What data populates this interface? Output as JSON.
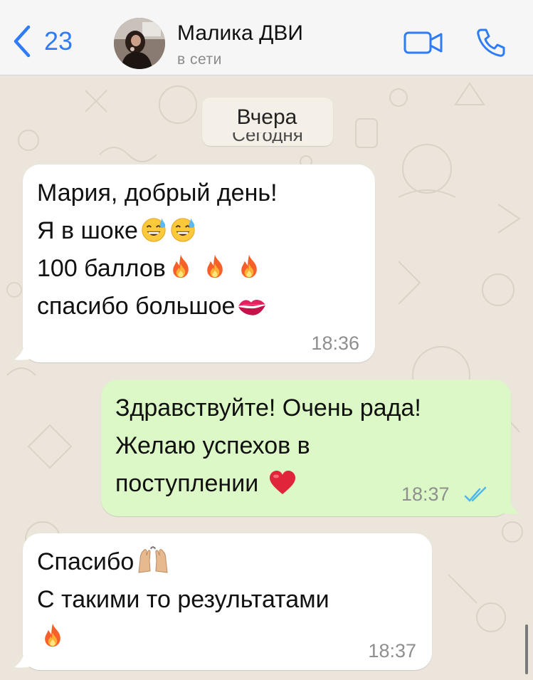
{
  "header": {
    "back_count": "23",
    "contact_name": "Малика ДВИ",
    "contact_status": "в сети"
  },
  "date_labels": {
    "overlay": "Вчера",
    "underlying": "Сегодня"
  },
  "messages": [
    {
      "direction": "incoming",
      "lines": [
        "Мария, добрый день!",
        "Я в шоке",
        "100 баллов",
        "спасибо большое"
      ],
      "emojis": [
        [],
        [
          "grinning-sweat-icon",
          "grinning-sweat-icon"
        ],
        [
          "fire-icon",
          "fire-icon",
          "fire-icon"
        ],
        [
          "kiss-mark-icon"
        ]
      ],
      "time": "18:36"
    },
    {
      "direction": "outgoing",
      "lines": [
        "Здравствуйте! Очень рада!",
        "Желаю успехов в",
        "поступлении"
      ],
      "emojis": [
        [],
        [],
        [
          "red-heart-icon"
        ]
      ],
      "time": "18:37",
      "read_receipt": "double-check-icon"
    },
    {
      "direction": "incoming",
      "lines": [
        "Спасибо",
        "С такими то результатами",
        ""
      ],
      "emojis": [
        [
          "raising-hands-icon"
        ],
        [],
        [
          "fire-icon"
        ]
      ],
      "time": "18:37"
    }
  ],
  "colors": {
    "accent": "#2f7cf6",
    "incoming_bubble": "#ffffff",
    "outgoing_bubble": "#dcf8c6",
    "chat_background": "#ebe5dc",
    "read_receipt": "#4fb6ec"
  }
}
